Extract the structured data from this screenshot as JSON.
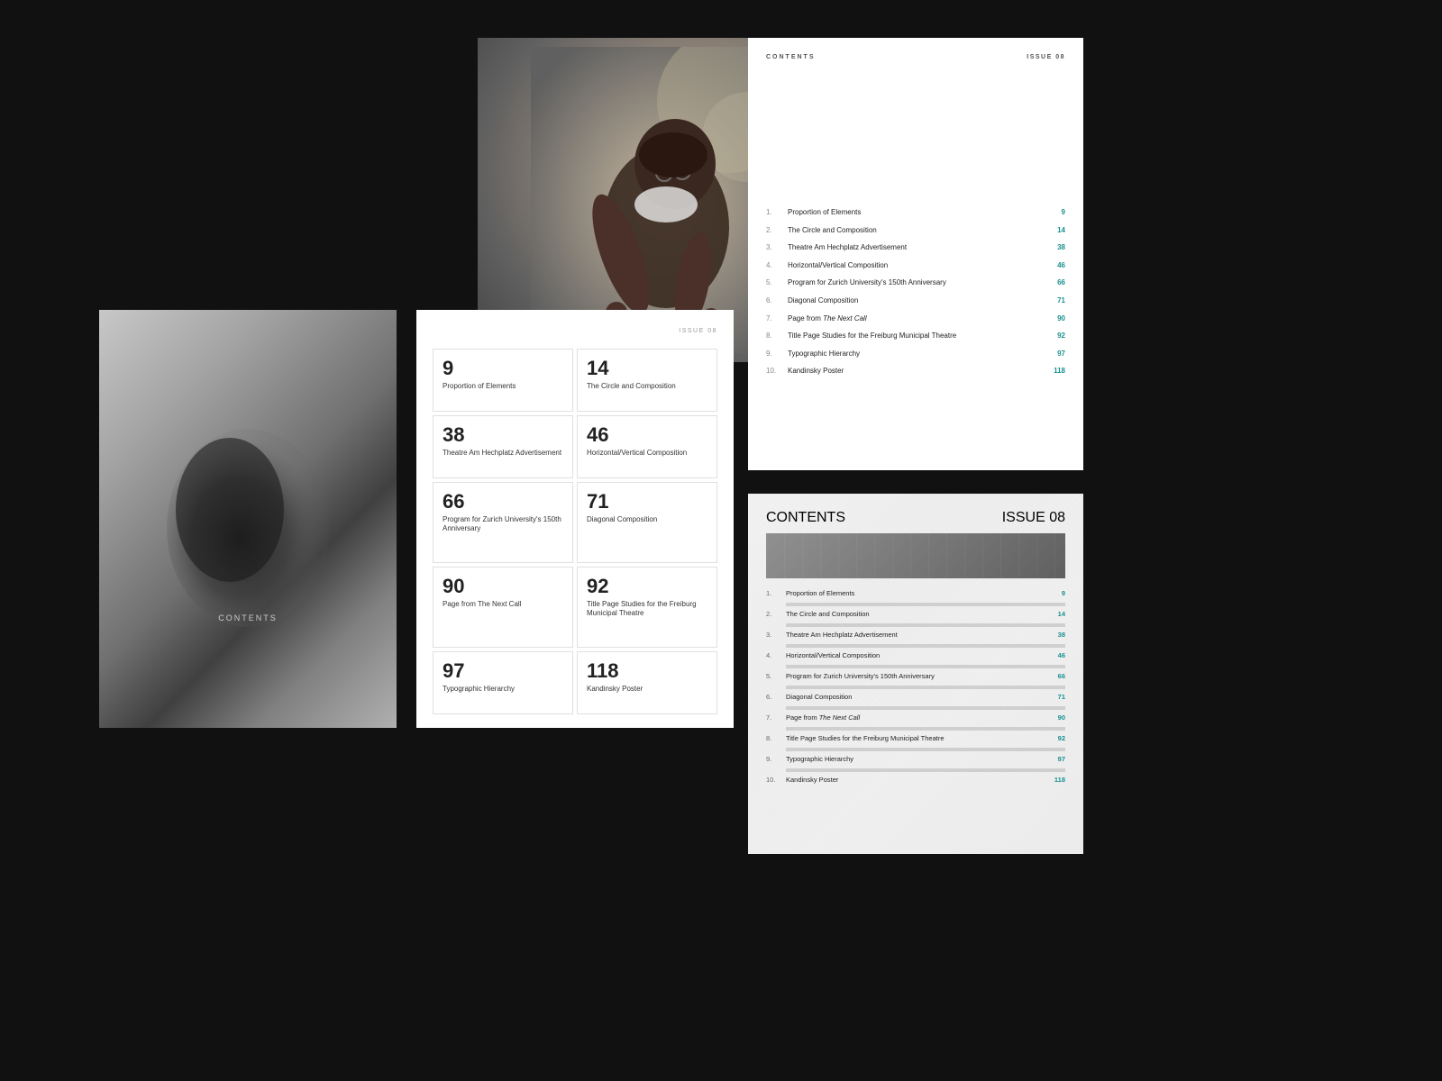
{
  "cover": {
    "label": "CONTENTS"
  },
  "contentsGrid": {
    "issueLabel": "ISSUE 08",
    "items": [
      {
        "number": "9",
        "title": "Proportion of Elements"
      },
      {
        "number": "14",
        "title": "The Circle and Composition"
      },
      {
        "number": "38",
        "title": "Theatre Am Hechplatz Advertisement"
      },
      {
        "number": "46",
        "title": "Horizontal/Vertical Composition"
      },
      {
        "number": "66",
        "title": "Program for Zurich University's 150th Anniversary"
      },
      {
        "number": "71",
        "title": "Diagonal Composition"
      },
      {
        "number": "90",
        "title": "Page from The Next Call"
      },
      {
        "number": "92",
        "title": "Title Page Studies for the Freiburg Municipal Theatre"
      },
      {
        "number": "97",
        "title": "Typographic Hierarchy"
      },
      {
        "number": "118",
        "title": "Kandinsky Poster"
      }
    ]
  },
  "tocCard": {
    "header": "CONTENTS",
    "issue": "ISSUE 08",
    "rows": [
      {
        "num": "1.",
        "title": "Proportion of Elements",
        "page": "9"
      },
      {
        "num": "2.",
        "title": "The Circle and Composition",
        "page": "14"
      },
      {
        "num": "3.",
        "title": "Theatre Am Hechplatz Advertisement",
        "page": "38"
      },
      {
        "num": "4.",
        "title": "Horizontal/Vertical Composition",
        "page": "46"
      },
      {
        "num": "5.",
        "title": "Program for Zurich University's 150th Anniversary",
        "page": "66"
      },
      {
        "num": "6.",
        "title": "Diagonal Composition",
        "page": "71"
      },
      {
        "num": "7.",
        "title": "Page from The Next Call",
        "page": "90",
        "italic": true
      },
      {
        "num": "8.",
        "title": "Title Page Studies for the Freiburg Municipal Theatre",
        "page": "92"
      },
      {
        "num": "9.",
        "title": "Typographic Hierarchy",
        "page": "97"
      },
      {
        "num": "10.",
        "title": "Kandinsky Poster",
        "page": "118"
      }
    ]
  },
  "tocTexture": {
    "header": "CONTENTS",
    "issue": "ISSUE 08",
    "rows": [
      {
        "num": "1.",
        "title": "Proportion of Elements",
        "page": "9"
      },
      {
        "num": "2.",
        "title": "The Circle and Composition",
        "page": "14"
      },
      {
        "num": "3.",
        "title": "Theatre Am Hechplatz Advertisement",
        "page": "38"
      },
      {
        "num": "4.",
        "title": "Horizontal/Vertical Composition",
        "page": "46"
      },
      {
        "num": "5.",
        "title": "Program for Zurich University's 150th Anniversary",
        "page": "66"
      },
      {
        "num": "6.",
        "title": "Diagonal Composition",
        "page": "71"
      },
      {
        "num": "7.",
        "title": "Page from The Next Call",
        "page": "90",
        "italic": true
      },
      {
        "num": "8.",
        "title": "Title Page Studies for the Freiburg Municipal Theatre",
        "page": "92"
      },
      {
        "num": "9.",
        "title": "Typographic Hierarchy",
        "page": "97"
      },
      {
        "num": "10.",
        "title": "Kandinsky Poster",
        "page": "118"
      }
    ]
  }
}
